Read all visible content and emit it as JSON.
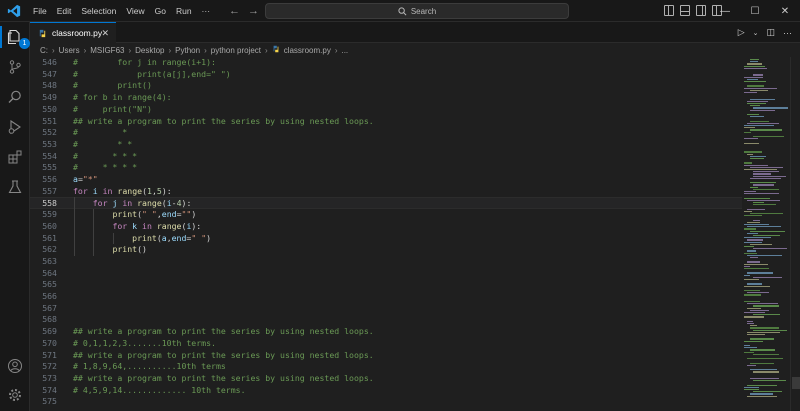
{
  "app": {
    "icon": "vscode-logo-icon",
    "accent_color": "#0078d4",
    "menu": [
      "File",
      "Edit",
      "Selection",
      "View",
      "Go",
      "Run",
      "···"
    ],
    "search_placeholder": "Search"
  },
  "activity_bar": {
    "items": [
      "explorer-icon",
      "source-control-icon",
      "search-icon",
      "run-debug-icon",
      "extensions-icon",
      "testing-icon"
    ],
    "explorer_badge": "1",
    "bottom_items": [
      "account-icon",
      "settings-gear-icon"
    ]
  },
  "tabs": [
    {
      "label": "classroom.py",
      "icon": "python-file-icon",
      "active": true
    }
  ],
  "breadcrumb": [
    "C:",
    "Users",
    "MSIGF63",
    "Desktop",
    "Python",
    "python project",
    "classroom.py",
    "..."
  ],
  "editor": {
    "current_line": 558,
    "lines": [
      {
        "n": "546",
        "tokens": [
          [
            "cm",
            "#        for j in range(i+1):"
          ]
        ]
      },
      {
        "n": "547",
        "tokens": [
          [
            "cm",
            "#            print(a[j],end=\" \")"
          ]
        ]
      },
      {
        "n": "548",
        "tokens": [
          [
            "cm",
            "#        print()"
          ]
        ]
      },
      {
        "n": "549",
        "tokens": [
          [
            "cm",
            "# for b in range(4):"
          ]
        ]
      },
      {
        "n": "550",
        "tokens": [
          [
            "cm",
            "#     print(\"N\")"
          ]
        ]
      },
      {
        "n": "551",
        "tokens": [
          [
            "cm",
            "## write a program to print the series by using nested loops."
          ]
        ]
      },
      {
        "n": "552",
        "tokens": [
          [
            "cm",
            "#         *"
          ]
        ]
      },
      {
        "n": "553",
        "tokens": [
          [
            "cm",
            "#        * *"
          ]
        ]
      },
      {
        "n": "554",
        "tokens": [
          [
            "cm",
            "#       * * *"
          ]
        ]
      },
      {
        "n": "555",
        "tokens": [
          [
            "cm",
            "#     * * * *"
          ]
        ]
      },
      {
        "n": "556",
        "tokens": [
          [
            "var",
            "a"
          ],
          [
            "op",
            "="
          ],
          [
            "str",
            "\"*\""
          ]
        ]
      },
      {
        "n": "557",
        "tokens": [
          [
            "kw",
            "for"
          ],
          [
            "op",
            " "
          ],
          [
            "var",
            "i"
          ],
          [
            "op",
            " "
          ],
          [
            "kw",
            "in"
          ],
          [
            "op",
            " "
          ],
          [
            "fn",
            "range"
          ],
          [
            "op",
            "("
          ],
          [
            "num",
            "1"
          ],
          [
            "op",
            ","
          ],
          [
            "num",
            "5"
          ],
          [
            "op",
            "):"
          ]
        ]
      },
      {
        "n": "558",
        "tokens": [
          [
            "op",
            "    "
          ],
          [
            "kw",
            "for"
          ],
          [
            "op",
            " "
          ],
          [
            "var",
            "j"
          ],
          [
            "op",
            " "
          ],
          [
            "kw",
            "in"
          ],
          [
            "op",
            " "
          ],
          [
            "fn",
            "range"
          ],
          [
            "op",
            "("
          ],
          [
            "var",
            "i"
          ],
          [
            "op",
            "-"
          ],
          [
            "num",
            "4"
          ],
          [
            "op",
            "):"
          ]
        ]
      },
      {
        "n": "559",
        "tokens": [
          [
            "op",
            "        "
          ],
          [
            "fn",
            "print"
          ],
          [
            "op",
            "("
          ],
          [
            "str",
            "\" \""
          ],
          [
            "op",
            ","
          ],
          [
            "var",
            "end"
          ],
          [
            "op",
            "="
          ],
          [
            "str",
            "\"\""
          ],
          [
            "op",
            ")"
          ]
        ]
      },
      {
        "n": "560",
        "tokens": [
          [
            "op",
            "        "
          ],
          [
            "kw",
            "for"
          ],
          [
            "op",
            " "
          ],
          [
            "var",
            "k"
          ],
          [
            "op",
            " "
          ],
          [
            "kw",
            "in"
          ],
          [
            "op",
            " "
          ],
          [
            "fn",
            "range"
          ],
          [
            "op",
            "("
          ],
          [
            "var",
            "i"
          ],
          [
            "op",
            "):"
          ]
        ]
      },
      {
        "n": "561",
        "tokens": [
          [
            "op",
            "            "
          ],
          [
            "fn",
            "print"
          ],
          [
            "op",
            "("
          ],
          [
            "var",
            "a"
          ],
          [
            "op",
            ","
          ],
          [
            "var",
            "end"
          ],
          [
            "op",
            "="
          ],
          [
            "str",
            "\" \""
          ],
          [
            "op",
            ")"
          ]
        ]
      },
      {
        "n": "562",
        "tokens": [
          [
            "op",
            "        "
          ],
          [
            "fn",
            "print"
          ],
          [
            "op",
            "()"
          ]
        ]
      },
      {
        "n": "563",
        "tokens": []
      },
      {
        "n": "564",
        "tokens": []
      },
      {
        "n": "565",
        "tokens": []
      },
      {
        "n": "566",
        "tokens": []
      },
      {
        "n": "567",
        "tokens": []
      },
      {
        "n": "568",
        "tokens": []
      },
      {
        "n": "569",
        "tokens": [
          [
            "cm",
            "## write a program to print the series by using nested loops."
          ]
        ]
      },
      {
        "n": "570",
        "tokens": [
          [
            "cm",
            "# 0,1,1,2,3.......10th terms."
          ]
        ]
      },
      {
        "n": "571",
        "tokens": [
          [
            "cm",
            "## write a program to print the series by using nested loops."
          ]
        ]
      },
      {
        "n": "572",
        "tokens": [
          [
            "cm",
            "# 1,8,9,64,..........10th terms"
          ]
        ]
      },
      {
        "n": "573",
        "tokens": [
          [
            "cm",
            "## write a program to print the series by using nested loops."
          ]
        ]
      },
      {
        "n": "574",
        "tokens": [
          [
            "cm",
            "# 4,5,9,14............. 10th terms."
          ]
        ]
      },
      {
        "n": "575",
        "tokens": []
      }
    ]
  },
  "colors": {
    "comment": "#6a9955",
    "keyword": "#c586c0",
    "function": "#dcdcaa",
    "variable": "#9cdcfe",
    "string": "#ce9178",
    "number": "#b5cea8"
  }
}
